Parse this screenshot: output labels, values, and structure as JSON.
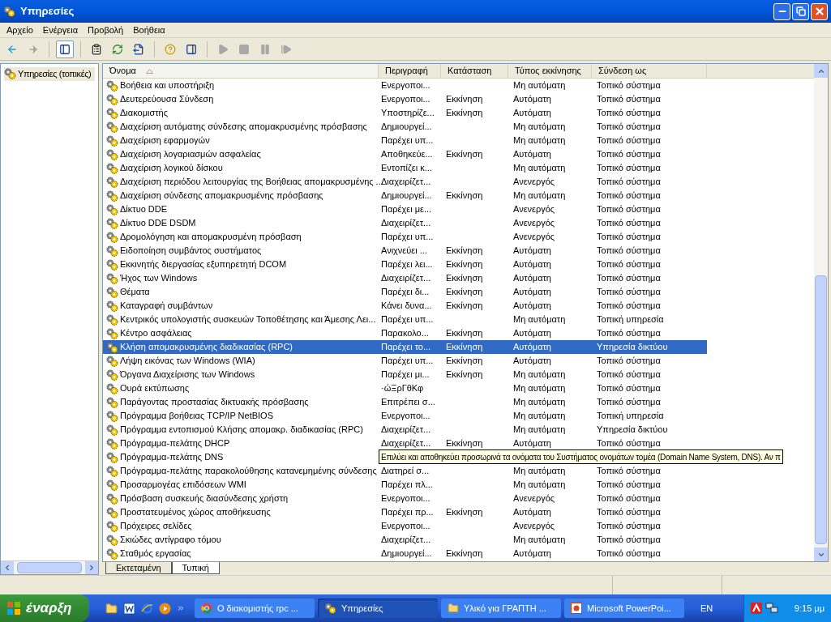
{
  "window": {
    "title": "Υπηρεσίες"
  },
  "menu": [
    "Αρχείο",
    "Ενέργεια",
    "Προβολή",
    "Βοήθεια"
  ],
  "toolbar": [
    {
      "kind": "back",
      "disabled": false,
      "selected": false
    },
    {
      "kind": "forward",
      "disabled": true,
      "selected": false
    },
    {
      "kind": "tree",
      "disabled": false,
      "selected": true
    },
    {
      "kind": "properties",
      "disabled": false,
      "selected": false
    },
    {
      "kind": "refresh",
      "disabled": false,
      "selected": false
    },
    {
      "kind": "export",
      "disabled": false,
      "selected": false
    },
    {
      "kind": "help",
      "disabled": false,
      "selected": false
    },
    {
      "kind": "panel",
      "disabled": false,
      "selected": false
    },
    {
      "kind": "play",
      "disabled": true,
      "selected": false
    },
    {
      "kind": "stop",
      "disabled": true,
      "selected": false
    },
    {
      "kind": "pause",
      "disabled": true,
      "selected": false
    },
    {
      "kind": "resume",
      "disabled": true,
      "selected": false
    }
  ],
  "tree": {
    "items": [
      {
        "label": "Υπηρεσίες (τοπικές)",
        "selected": true
      }
    ]
  },
  "columns": [
    {
      "label": "Όνομα",
      "sorted": true
    },
    {
      "label": "Περιγραφή",
      "sorted": false
    },
    {
      "label": "Κατάσταση",
      "sorted": false
    },
    {
      "label": "Τύπος εκκίνησης",
      "sorted": false
    },
    {
      "label": "Σύνδεση ως",
      "sorted": false
    }
  ],
  "rows": [
    {
      "name": "Βοήθεια και υποστήριξη",
      "description": "Ενεργοποι...",
      "startup": "Μη αυτόματη",
      "logon": "Τοπικό σύστημα",
      "selected": false
    },
    {
      "name": "Δευτερεύουσα Σύνδεση",
      "description": "Ενεργοποι...",
      "status": "Εκκίνηση",
      "startup": "Αυτόματη",
      "logon": "Τοπικό σύστημα",
      "selected": false
    },
    {
      "name": "Διακομιστής",
      "description": "Υποστηρίζε...",
      "status": "Εκκίνηση",
      "startup": "Αυτόματη",
      "logon": "Τοπικό σύστημα",
      "selected": false
    },
    {
      "name": "Διαχείριση αυτόματης σύνδεσης απομακρυσμένης πρόσβασης",
      "description": "Δημιουργεί...",
      "startup": "Μη αυτόματη",
      "logon": "Τοπικό σύστημα",
      "selected": false
    },
    {
      "name": "Διαχείριση εφαρμογών",
      "description": "Παρέχει υπ...",
      "startup": "Μη αυτόματη",
      "logon": "Τοπικό σύστημα",
      "selected": false
    },
    {
      "name": "Διαχείριση λογαριασμών ασφαλείας",
      "description": "Αποθηκεύε...",
      "status": "Εκκίνηση",
      "startup": "Αυτόματη",
      "logon": "Τοπικό σύστημα",
      "selected": false
    },
    {
      "name": "Διαχείριση λογικού δίσκου",
      "description": "Εντοπίζει κ...",
      "startup": "Μη αυτόματη",
      "logon": "Τοπικό σύστημα",
      "selected": false
    },
    {
      "name": "Διαχείριση περιόδου λειτουργίας της Βοήθειας απομακρυσμένης ...",
      "description": "Διαχειρίζετ...",
      "startup": "Ανενεργός",
      "logon": "Τοπικό σύστημα",
      "selected": false
    },
    {
      "name": "Διαχείριση σύνδεσης απομακρυσμένης πρόσβασης",
      "description": "Δημιουργεί...",
      "status": "Εκκίνηση",
      "startup": "Μη αυτόματη",
      "logon": "Τοπικό σύστημα",
      "selected": false
    },
    {
      "name": "Δίκτυο DDE",
      "description": "Παρέχει με...",
      "startup": "Ανενεργός",
      "logon": "Τοπικό σύστημα",
      "selected": false
    },
    {
      "name": "Δίκτυο DDE DSDM",
      "description": "Διαχειρίζετ...",
      "startup": "Ανενεργός",
      "logon": "Τοπικό σύστημα",
      "selected": false
    },
    {
      "name": "Δρομολόγηση και απομακρυσμένη πρόσβαση",
      "description": "Παρέχει υπ...",
      "startup": "Ανενεργός",
      "logon": "Τοπικό σύστημα",
      "selected": false
    },
    {
      "name": "Ειδοποίηση συμβάντος συστήματος",
      "description": "Ανιχνεύει ...",
      "status": "Εκκίνηση",
      "startup": "Αυτόματη",
      "logon": "Τοπικό σύστημα",
      "selected": false
    },
    {
      "name": "Εκκινητής διεργασίας εξυπηρετητή DCOM",
      "description": "Παρέχει λει...",
      "status": "Εκκίνηση",
      "startup": "Αυτόματη",
      "logon": "Τοπικό σύστημα",
      "selected": false
    },
    {
      "name": "Ήχος των Windows",
      "description": "Διαχειρίζετ...",
      "status": "Εκκίνηση",
      "startup": "Αυτόματη",
      "logon": "Τοπικό σύστημα",
      "selected": false
    },
    {
      "name": "Θέματα",
      "description": "Παρέχει δι...",
      "status": "Εκκίνηση",
      "startup": "Αυτόματη",
      "logon": "Τοπικό σύστημα",
      "selected": false
    },
    {
      "name": "Καταγραφή συμβάντων",
      "description": "Κάνει δυνα...",
      "status": "Εκκίνηση",
      "startup": "Αυτόματη",
      "logon": "Τοπικό σύστημα",
      "selected": false
    },
    {
      "name": "Κεντρικός υπολογιστής συσκευών Τοποθέτησης και Άμεσης Λει...",
      "description": "Παρέχει υπ...",
      "startup": "Μη αυτόματη",
      "logon": "Τοπική υπηρεσία",
      "selected": false
    },
    {
      "name": "Κέντρο ασφάλειας",
      "description": "Παρακολο...",
      "status": "Εκκίνηση",
      "startup": "Αυτόματη",
      "logon": "Τοπικό σύστημα",
      "selected": false
    },
    {
      "name": "Κλήση απομακρυσμένης διαδικασίας (RPC)",
      "description": "Παρέχει το...",
      "status": "Εκκίνηση",
      "startup": "Αυτόματη",
      "logon": "Υπηρεσία δικτύου",
      "selected": true
    },
    {
      "name": "Λήψη εικόνας των Windows (WIA)",
      "description": "Παρέχει υπ...",
      "status": "Εκκίνηση",
      "startup": "Αυτόματη",
      "logon": "Τοπικό σύστημα",
      "selected": false
    },
    {
      "name": "Όργανα Διαχείρισης των Windows",
      "description": "Παρέχει μι...",
      "status": "Εκκίνηση",
      "startup": "Μη αυτόματη",
      "logon": "Τοπικό σύστημα",
      "selected": false
    },
    {
      "name": "Ουρά εκτύπωσης",
      "description": "·ώΞρΓθΚφ",
      "startup": "Μη αυτόματη",
      "logon": "Τοπικό σύστημα",
      "selected": false
    },
    {
      "name": "Παράγοντας προστασίας δικτυακής πρόσβασης",
      "description": "Επιτρέπει σ...",
      "startup": "Μη αυτόματη",
      "logon": "Τοπικό σύστημα",
      "selected": false
    },
    {
      "name": "Πρόγραμμα βοήθειας TCP/IP NetBIOS",
      "description": "Ενεργοποι...",
      "startup": "Μη αυτόματη",
      "logon": "Τοπική υπηρεσία",
      "selected": false
    },
    {
      "name": "Πρόγραμμα εντοπισμού Κλήσης απομακρ. διαδικασίας (RPC)",
      "description": "Διαχειρίζετ...",
      "startup": "Μη αυτόματη",
      "logon": "Υπηρεσία δικτύου",
      "selected": false
    },
    {
      "name": "Πρόγραμμα-πελάτης DHCP",
      "description": "Διαχειρίζετ...",
      "status": "Εκκίνηση",
      "startup": "Αυτόματη",
      "logon": "Τοπικό σύστημα",
      "selected": false
    },
    {
      "name": "Πρόγραμμα-πελάτης DNS",
      "tooltip": "Επιλύει και αποθηκεύει προσωρινά τα ονόματα του Συστήματος ονομάτων τομέα (Domain Name System, DNS). Αν π",
      "selected": false
    },
    {
      "name": "Πρόγραμμα-πελάτης παρακολούθησης κατανεμημένης σύνδεσης",
      "description": "Διατηρεί σ...",
      "startup": "Μη αυτόματη",
      "logon": "Τοπικό σύστημα",
      "selected": false
    },
    {
      "name": "Προσαρμογέας επιδόσεων WMI",
      "description": "Παρέχει πλ...",
      "startup": "Μη αυτόματη",
      "logon": "Τοπικό σύστημα",
      "selected": false
    },
    {
      "name": "Πρόσβαση συσκευής διασύνδεσης χρήστη",
      "description": "Ενεργοποι...",
      "startup": "Ανενεργός",
      "logon": "Τοπικό σύστημα",
      "selected": false
    },
    {
      "name": "Προστατευμένος χώρος αποθήκευσης",
      "description": "Παρέχει πρ...",
      "status": "Εκκίνηση",
      "startup": "Αυτόματη",
      "logon": "Τοπικό σύστημα",
      "selected": false
    },
    {
      "name": "Πρόχειρες σελίδες",
      "description": "Ενεργοποι...",
      "startup": "Ανενεργός",
      "logon": "Τοπικό σύστημα",
      "selected": false
    },
    {
      "name": "Σκιώδες αντίγραφο τόμου",
      "description": "Διαχειρίζετ...",
      "startup": "Μη αυτόματη",
      "logon": "Τοπικό σύστημα",
      "selected": false
    },
    {
      "name": "Σταθμός εργασίας",
      "description": "Δημιουργεί...",
      "status": "Εκκίνηση",
      "startup": "Αυτόματη",
      "logon": "Τοπικό σύστημα",
      "selected": false
    }
  ],
  "view_tabs": [
    {
      "label": "Εκτεταμένη",
      "selected": false
    },
    {
      "label": "Τυπική",
      "selected": true
    }
  ],
  "taskbar": {
    "start": "έναρξη",
    "quick_launch": [
      {
        "kind": "folder"
      },
      {
        "kind": "word"
      },
      {
        "kind": "ie"
      },
      {
        "kind": "media"
      }
    ],
    "tasks": [
      {
        "kind": "chrome",
        "label": "Ο διακομιστής rpc ...",
        "selected": false
      },
      {
        "kind": "services",
        "label": "Υπηρεσίες",
        "selected": true
      },
      {
        "kind": "folder",
        "label": "Υλικό για ΓΡΑΠΤΗ ...",
        "selected": false
      },
      {
        "kind": "powerpoint",
        "label": "Microsoft PowerPoi...",
        "selected": false
      }
    ],
    "language": "EN",
    "clock": "9:15 μμ"
  }
}
